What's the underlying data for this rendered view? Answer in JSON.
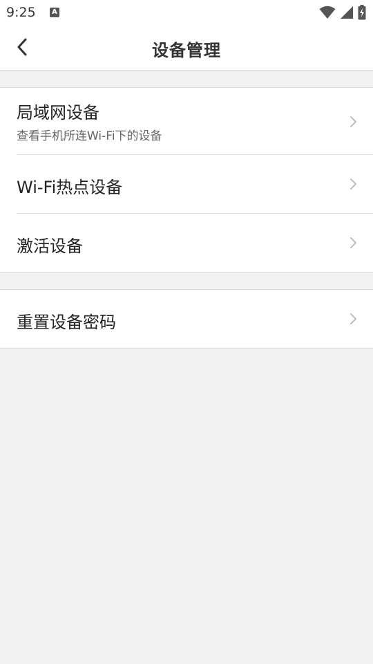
{
  "status_bar": {
    "time": "9:25",
    "notification_icon": "a-notification-icon",
    "wifi_icon": "wifi-icon",
    "signal_icon": "signal-icon",
    "battery_icon": "battery-charging-icon"
  },
  "toolbar": {
    "back_icon": "chevron-left-icon",
    "title": "设备管理"
  },
  "groups": [
    {
      "items": [
        {
          "title": "局域网设备",
          "subtitle": "查看手机所连Wi-Fi下的设备"
        },
        {
          "title": "Wi-Fi热点设备"
        },
        {
          "title": "激活设备"
        }
      ]
    },
    {
      "items": [
        {
          "title": "重置设备密码"
        }
      ]
    }
  ],
  "colors": {
    "background": "#f2f2f2",
    "surface": "#ffffff",
    "text_primary": "#222222",
    "text_secondary": "#666666",
    "chevron": "#bdbdbd"
  }
}
